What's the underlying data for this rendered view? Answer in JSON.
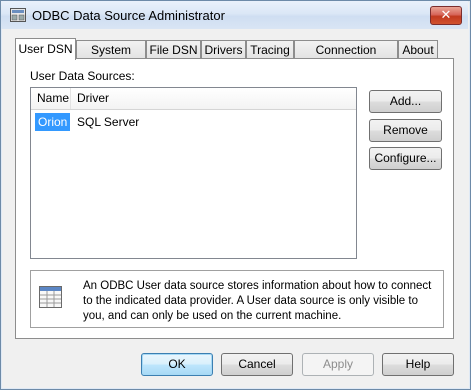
{
  "window": {
    "title": "ODBC Data Source Administrator",
    "close_label": "✕"
  },
  "tabs": [
    {
      "label": "User DSN"
    },
    {
      "label": "System DSN"
    },
    {
      "label": "File DSN"
    },
    {
      "label": "Drivers"
    },
    {
      "label": "Tracing"
    },
    {
      "label": "Connection Pooling"
    },
    {
      "label": "About"
    }
  ],
  "user_dsn": {
    "section_label": "User Data Sources:",
    "columns": {
      "name": "Name",
      "driver": "Driver"
    },
    "rows": [
      {
        "name": "Orion",
        "driver": "SQL Server"
      }
    ],
    "buttons": {
      "add": "Add...",
      "remove": "Remove",
      "configure": "Configure..."
    },
    "info_text": "An ODBC User data source stores information about how to connect to the indicated data provider.   A User data source is only visible to you, and can only be used on the current machine."
  },
  "footer": {
    "ok": "OK",
    "cancel": "Cancel",
    "apply": "Apply",
    "help": "Help"
  },
  "colors": {
    "selection": "#3399ff",
    "accent_border": "#3c7fb1"
  },
  "icons": {
    "app": "odbc-app-icon",
    "close": "close-icon",
    "info": "database-table-icon"
  }
}
